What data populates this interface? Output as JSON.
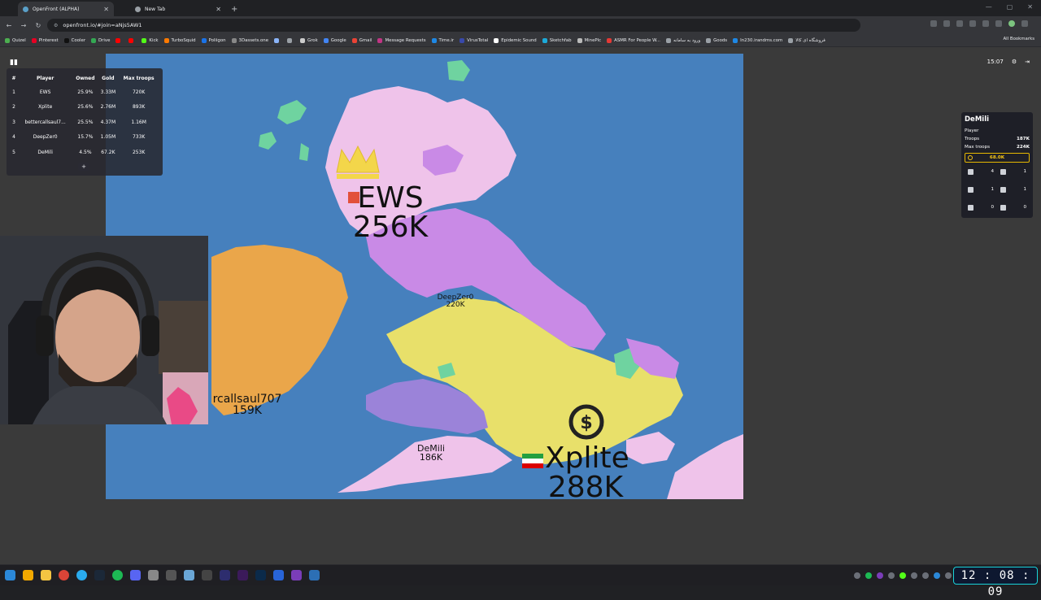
{
  "browser": {
    "tabs": [
      {
        "title": "OpenFront (ALPHA)",
        "active": true
      },
      {
        "title": "New Tab",
        "active": false
      }
    ],
    "url": "openfront.io/#join=aNjs5AW1",
    "bookmarks": [
      {
        "label": "Quizel",
        "color": "#4caf50"
      },
      {
        "label": "Pinterest",
        "color": "#e60023"
      },
      {
        "label": "Cooler",
        "color": "#111111"
      },
      {
        "label": "Drive",
        "color": "#34a853"
      },
      {
        "label": "",
        "color": "#ff0000"
      },
      {
        "label": "",
        "color": "#ff0000"
      },
      {
        "label": "Kick",
        "color": "#53fc18"
      },
      {
        "label": "TurboSquid",
        "color": "#ff7a00"
      },
      {
        "label": "Poliigon",
        "color": "#1a73e8"
      },
      {
        "label": "3Dassets.one",
        "color": "#888888"
      },
      {
        "label": "",
        "color": "#8ab4f8"
      },
      {
        "label": "",
        "color": "#9aa0a6"
      },
      {
        "label": "Grok",
        "color": "#cccccc"
      },
      {
        "label": "Google",
        "color": "#4285f4"
      },
      {
        "label": "Gmail",
        "color": "#ea4335"
      },
      {
        "label": "Message Requests",
        "color": "#c13584"
      },
      {
        "label": "Time.ir",
        "color": "#1e88e5"
      },
      {
        "label": "VirusTotal",
        "color": "#3949ab"
      },
      {
        "label": "Epidemic Sound",
        "color": "#ffffff"
      },
      {
        "label": "Sketchfab",
        "color": "#1caad9"
      },
      {
        "label": "MinePlc",
        "color": "#bbbbbb"
      },
      {
        "label": "ASMR For People W...",
        "color": "#e53935"
      },
      {
        "label": "ورود به سامانه",
        "color": "#9aa0a6"
      },
      {
        "label": "Goods",
        "color": "#9aa0a6"
      },
      {
        "label": "In230.irandms.com",
        "color": "#1e88e5"
      },
      {
        "label": "فروشگاه ای کالا",
        "color": "#9aa0a6"
      }
    ],
    "all_bookmarks": "All Bookmarks"
  },
  "leaderboard": {
    "headers": [
      "#",
      "Player",
      "Owned",
      "Gold",
      "Max troops"
    ],
    "rows": [
      [
        "1",
        "EWS",
        "25.9%",
        "3.33M",
        "720K"
      ],
      [
        "2",
        "Xplite",
        "25.6%",
        "2.76M",
        "893K"
      ],
      [
        "3",
        "bettercallsaul7...",
        "25.5%",
        "4.37M",
        "1.16M"
      ],
      [
        "4",
        "DeepZer0",
        "15.7%",
        "1.05M",
        "733K"
      ],
      [
        "5",
        "DeMili",
        "4.5%",
        "67.2K",
        "253K"
      ]
    ],
    "more": "+"
  },
  "game_clock": "15:07",
  "player_panel": {
    "name": "DeMili",
    "type": "Player",
    "troops_label": "Troops",
    "troops": "187K",
    "max_troops_label": "Max troops",
    "max_troops": "224K",
    "gold": "68.0K",
    "counts": [
      "4",
      "1",
      "1",
      "1",
      "0",
      "0"
    ]
  },
  "map_labels": {
    "ews_name": "EWS",
    "ews_troops": "256K",
    "deepzer0_name": "DeepZer0",
    "deepzer0_troops": "220K",
    "saul_name": "rcallsaul707",
    "saul_troops": "159K",
    "demili_name": "DeMili",
    "demili_troops": "186K",
    "xplite_name": "Xplite",
    "xplite_troops": "288K"
  },
  "colors": {
    "ocean": "#4680bd",
    "ews": "#efc3ea",
    "deepzer0": "#c98ae6",
    "xplite": "#e8e06a",
    "saul": "#eaa64a",
    "demili": "#9b83d9",
    "neutral_green": "#6fd3a0"
  },
  "taskbar_clock": "12 : 08 : 09"
}
